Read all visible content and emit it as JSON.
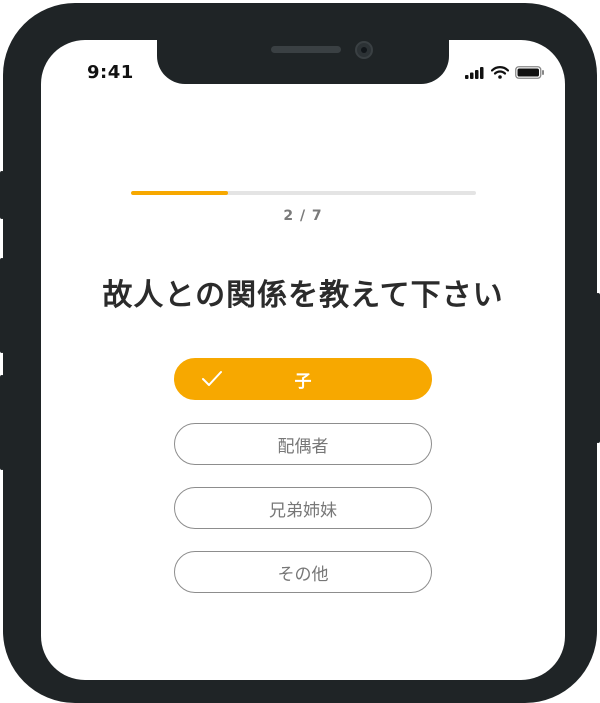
{
  "status_bar": {
    "time": "9:41"
  },
  "questionnaire": {
    "progress_fraction": 0.28,
    "step_label": "2 / 7",
    "title": "故人との関係を教えて下さい",
    "options": [
      {
        "label": "子",
        "selected": true
      },
      {
        "label": "配偶者",
        "selected": false
      },
      {
        "label": "兄弟姉妹",
        "selected": false
      },
      {
        "label": "その他",
        "selected": false
      }
    ]
  },
  "colors": {
    "accent": "#f7a800",
    "frame": "#1f2426"
  },
  "icons": [
    "signal-icon",
    "wifi-icon",
    "battery-icon",
    "check-icon"
  ]
}
